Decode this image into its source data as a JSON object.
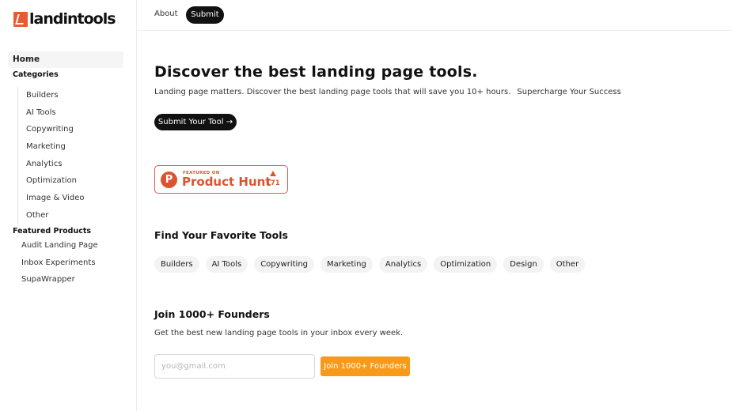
{
  "logo": {
    "text": "landintools",
    "icon": "landintools-logo-icon",
    "brand_color": "#e85a32"
  },
  "topbar": {
    "about": "About",
    "submit": "Submit"
  },
  "sidebar": {
    "home": "Home",
    "categories_heading": "Categories",
    "categories": [
      "Builders",
      "AI Tools",
      "Copywriting",
      "Marketing",
      "Analytics",
      "Optimization",
      "Image & Video",
      "Other"
    ],
    "featured_heading": "Featured Products",
    "featured": [
      "Audit Landing Page",
      "Inbox Experiments",
      "SupaWrapper"
    ]
  },
  "hero": {
    "title": "Discover the best landing page tools.",
    "subtitle": "Landing page matters. Discover the best landing page tools that will save you 10+ hours.",
    "tagline": "Supercharge Your Success",
    "cta": "Submit Your Tool →"
  },
  "product_hunt": {
    "featured_on": "FEATURED ON",
    "name": "Product Hunt",
    "count": "171",
    "color": "#da552f",
    "icon": "product-hunt-icon"
  },
  "favorites": {
    "title": "Find Your Favorite Tools",
    "chips": [
      "Builders",
      "AI Tools",
      "Copywriting",
      "Marketing",
      "Analytics",
      "Optimization",
      "Design",
      "Other"
    ]
  },
  "newsletter": {
    "title": "Join 1000+ Founders",
    "subtitle": "Get the best new landing page tools in your inbox every week.",
    "placeholder": "you@gmail.com",
    "button": "Join 1000+ Founders",
    "button_color": "#f79a1a"
  }
}
